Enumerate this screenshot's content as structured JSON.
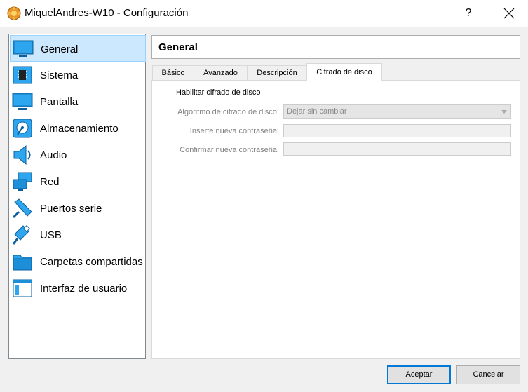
{
  "window": {
    "title": "MiquelAndres-W10 - Configuración",
    "help": "?"
  },
  "sidebar": {
    "items": [
      {
        "label": "General",
        "icon": "monitor-icon",
        "selected": true
      },
      {
        "label": "Sistema",
        "icon": "chip-icon"
      },
      {
        "label": "Pantalla",
        "icon": "display-icon"
      },
      {
        "label": "Almacenamiento",
        "icon": "disk-icon"
      },
      {
        "label": "Audio",
        "icon": "speaker-icon"
      },
      {
        "label": "Red",
        "icon": "network-icon"
      },
      {
        "label": "Puertos serie",
        "icon": "serial-port-icon"
      },
      {
        "label": "USB",
        "icon": "usb-icon"
      },
      {
        "label": "Carpetas compartidas",
        "icon": "folder-icon"
      },
      {
        "label": "Interfaz de usuario",
        "icon": "ui-window-icon"
      }
    ]
  },
  "header": {
    "title": "General"
  },
  "tabs": [
    {
      "label": "Básico"
    },
    {
      "label": "Avanzado"
    },
    {
      "label": "Descripción"
    },
    {
      "label": "Cifrado de disco",
      "active": true
    }
  ],
  "encryption": {
    "enable_label": "Habilitar cifrado de disco",
    "enable_checked": false,
    "algorithm_label": "Algoritmo de cifrado de disco:",
    "algorithm_value": "Dejar sin cambiar",
    "password_label": "Inserte nueva contraseña:",
    "password_value": "",
    "confirm_label": "Confirmar nueva contraseña:",
    "confirm_value": ""
  },
  "buttons": {
    "accept": "Aceptar",
    "cancel": "Cancelar"
  },
  "colors": {
    "selection_bg": "#cce8ff",
    "accent": "#0078d7",
    "icon_blue": "#1c8fd8"
  }
}
